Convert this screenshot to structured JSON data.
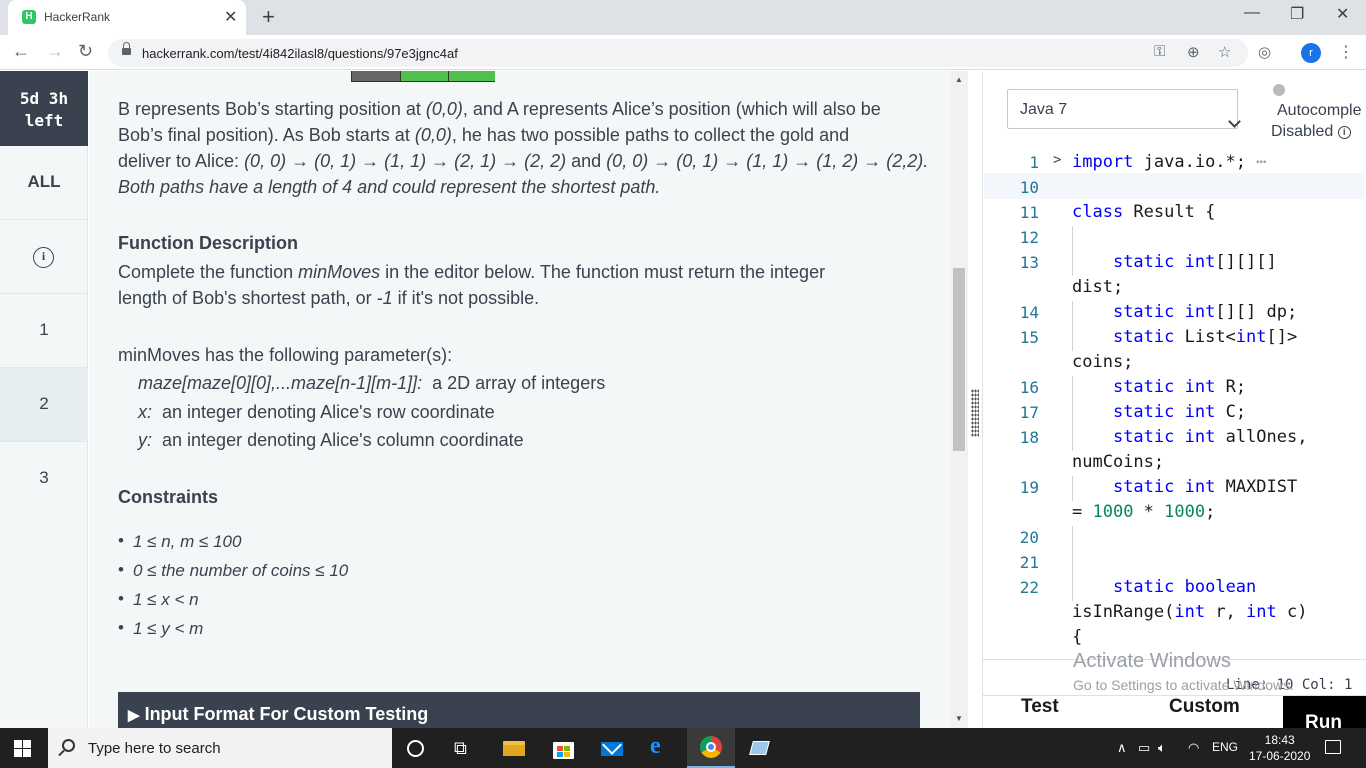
{
  "browser": {
    "tab_title": "HackerRank",
    "tab_favicon": "H",
    "tab_close": "✕",
    "new_tab": "+",
    "url": "hackerrank.com/test/4i842ilasl8/questions/97e3jgnc4af",
    "profile_initial": "r",
    "window_controls": [
      "—",
      "❐",
      "✕"
    ]
  },
  "left_nav": {
    "timer_line1": "5d 3h",
    "timer_line2": "left",
    "all_label": "ALL",
    "items": [
      "1",
      "2",
      "3"
    ],
    "active_item": "2"
  },
  "problem": {
    "p1_line1_a": "B represents Bob’s starting position at ",
    "p1_line1_b": "(0,0)",
    "p1_line1_c": ", and A represents Alice’s position (which will also be",
    "p1_line2_a": "Bob’s final position). As Bob starts at ",
    "p1_line2_b": "(0,0)",
    "p1_line2_c": ", he has two possible paths to collect the gold and",
    "p1_line3_a": "deliver to Alice: ",
    "p1_line3_b": "(0, 0) → (0, 1) → (1, 1) → (2, 1) → (2, 2)",
    "p1_line3_c": " and ",
    "p1_line3_d": "(0, 0) → (0, 1) → (1, 1) → (1, 2) → (2,2).",
    "p1_line4": "Both paths have a length of 4 and could represent the shortest path.",
    "func_heading": "Function Description",
    "func_line1_a": "Complete the function ",
    "func_line1_b": "minMoves",
    "func_line1_c": " in the editor below. The function must return the integer",
    "func_line2_a": "length of Bob's shortest path, or ",
    "func_line2_b": "-1",
    "func_line2_c": " if it's not possible.",
    "params_intro": "minMoves has the following parameter(s):",
    "params": [
      {
        "name": "maze[maze[0][0],...maze[n-1][m-1]]:",
        "desc": "  a 2D array of integers"
      },
      {
        "name": "x:",
        "desc": "  an integer denoting Alice's row coordinate"
      },
      {
        "name": "y:",
        "desc": "  an integer denoting Alice's column coordinate"
      }
    ],
    "constraints_heading": "Constraints",
    "constraints": [
      "1 ≤ n, m ≤ 100",
      "0 ≤ the number of coins ≤ 10",
      "1 ≤ x < n",
      "1 ≤ y < m"
    ],
    "input_format_label": "Input Format For Custom Testing",
    "input_format_arrow": "▶"
  },
  "editor": {
    "language": "Java 7",
    "autocomplete_line1": "Autocomple",
    "autocomplete_line2": "Disabled",
    "info_glyph": "i",
    "line_col": "Line: 10 Col: 1",
    "watermark_title": "Activate Windows",
    "watermark_sub": "Go to Settings to activate Windows.",
    "footer_test": "Test",
    "footer_custom": "Custom",
    "run_label": "Run",
    "code_lines": {
      "l1_num": "1",
      "l1_fold": ">",
      "l1_kw": "import",
      "l1_rest": " java.io.*;",
      "l1_ellipsis": " ⋯",
      "l10_num": "10",
      "l11_num": "11",
      "l11_kw": "class",
      "l11_rest": " Result {",
      "l12_num": "12",
      "l13_num": "13",
      "l13_kw1": "static",
      "l13_kw2": "int",
      "l13_rest": "[][][]",
      "l13_wrap": "dist;",
      "l14_num": "14",
      "l14_kw1": "static",
      "l14_kw2": "int",
      "l14_rest": "[][] dp;",
      "l15_num": "15",
      "l15_kw1": "static",
      "l15_mid": " List<",
      "l15_kw2": "int",
      "l15_rest": "[]>",
      "l15_wrap": "coins;",
      "l16_num": "16",
      "l16_kw1": "static",
      "l16_kw2": "int",
      "l16_rest": " R;",
      "l17_num": "17",
      "l17_kw1": "static",
      "l17_kw2": "int",
      "l17_rest": " C;",
      "l18_num": "18",
      "l18_kw1": "static",
      "l18_kw2": "int",
      "l18_rest": " allOnes,",
      "l18_wrap": "numCoins;",
      "l19_num": "19",
      "l19_kw1": "static",
      "l19_kw2": "int",
      "l19_rest": " MAXDIST",
      "l19_wrap_a": "= ",
      "l19_n1": "1000",
      "l19_wrap_b": " * ",
      "l19_n2": "1000",
      "l19_wrap_c": ";",
      "l20_num": "20",
      "l21_num": "21",
      "l22_num": "22",
      "l22_kw1": "static",
      "l22_kw2": "boolean",
      "l22_wrap_a": "isInRange(",
      "l22_wk1": "int",
      "l22_wrap_b": " r, ",
      "l22_wk2": "int",
      "l22_wrap_c": " c)",
      "l22_wrap2": "{"
    }
  },
  "taskbar": {
    "search_placeholder": "Type here to search",
    "tray_lang": "ENG",
    "time": "18:43",
    "date": "17-06-2020"
  }
}
